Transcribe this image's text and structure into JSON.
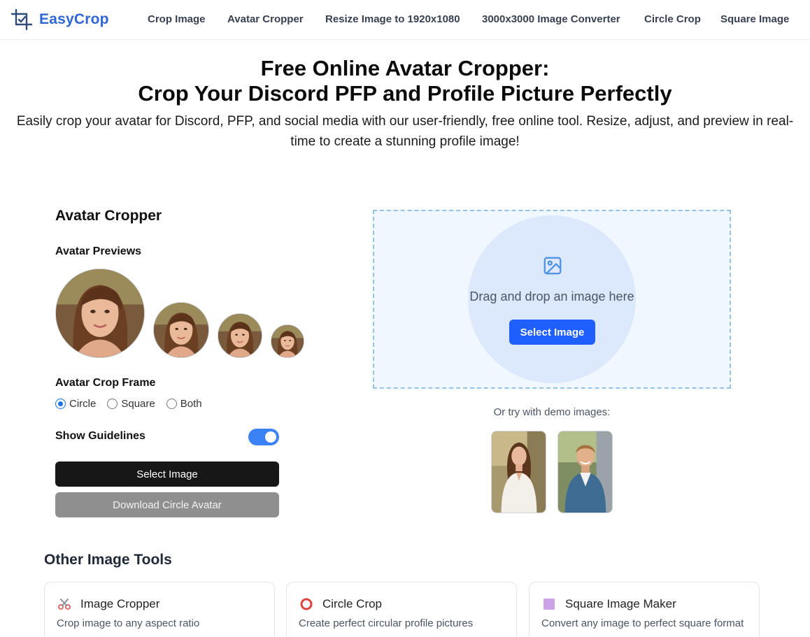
{
  "brand": {
    "name": "EasyCrop",
    "color": "#2f66d6"
  },
  "nav": {
    "items": [
      {
        "label": "Crop Image"
      },
      {
        "label": "Avatar Cropper"
      },
      {
        "label": "Resize Image to 1920x1080"
      },
      {
        "label": "3000x3000 Image Converter"
      },
      {
        "label": "Circle Crop"
      },
      {
        "label": "Square Image"
      }
    ]
  },
  "hero": {
    "title_line1": "Free Online Avatar Cropper:",
    "title_line2": "Crop Your Discord PFP and Profile Picture Perfectly",
    "subtitle": "Easily crop your avatar for Discord, PFP, and social media with our user-friendly, free online tool. Resize, adjust, and preview in real-time to create a stunning profile image!"
  },
  "cropper": {
    "title": "Avatar Cropper",
    "previews_label": "Avatar Previews",
    "frame_label": "Avatar Crop Frame",
    "frame_options": [
      {
        "label": "Circle",
        "checked": true
      },
      {
        "label": "Square",
        "checked": false
      },
      {
        "label": "Both",
        "checked": false
      }
    ],
    "guidelines_label": "Show Guidelines",
    "guidelines_on": true,
    "select_button": "Select Image",
    "download_button": "Download Circle Avatar"
  },
  "dropzone": {
    "icon": "image-icon",
    "text": "Drag and drop an image here",
    "button": "Select Image",
    "accent": "#1f5eff"
  },
  "demo": {
    "label": "Or try with demo images:"
  },
  "tools": {
    "title": "Other Image Tools",
    "cards": [
      {
        "icon": "scissors-icon",
        "title": "Image Cropper",
        "desc": "Crop image to any aspect ratio"
      },
      {
        "icon": "circle-icon",
        "title": "Circle Crop",
        "desc": "Create perfect circular profile pictures"
      },
      {
        "icon": "square-icon",
        "title": "Square Image Maker",
        "desc": "Convert any image to perfect square format"
      }
    ]
  }
}
